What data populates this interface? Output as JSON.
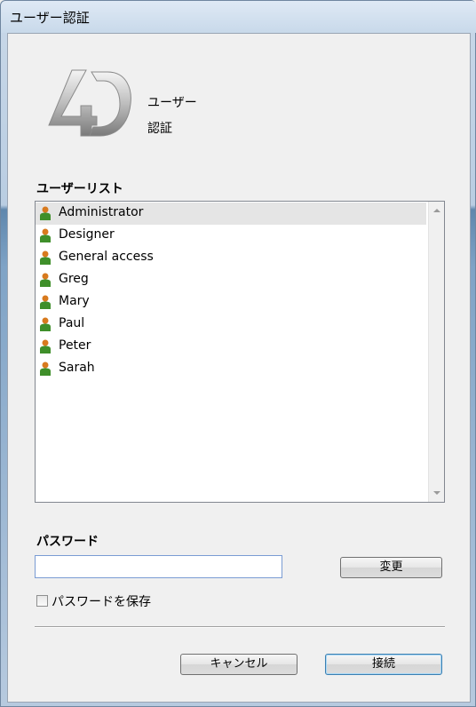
{
  "window": {
    "title": "ユーザー認証"
  },
  "logo": {
    "line1": "ユーザー",
    "line2": "認証"
  },
  "user_list": {
    "label": "ユーザーリスト",
    "selected_index": 0,
    "items": [
      {
        "label": "Administrator"
      },
      {
        "label": "Designer"
      },
      {
        "label": "General access"
      },
      {
        "label": "Greg"
      },
      {
        "label": "Mary"
      },
      {
        "label": "Paul"
      },
      {
        "label": "Peter"
      },
      {
        "label": "Sarah"
      }
    ]
  },
  "password": {
    "label": "パスワード",
    "value": "",
    "change_button": "変更",
    "save_checkbox_label": "パスワードを保存",
    "save_checked": false
  },
  "buttons": {
    "cancel": "キャンセル",
    "connect": "接続"
  },
  "colors": {
    "accent_border": "#3c7fb1",
    "icon_user_body": "#3f8f2a",
    "icon_user_head": "#d87a1e"
  }
}
